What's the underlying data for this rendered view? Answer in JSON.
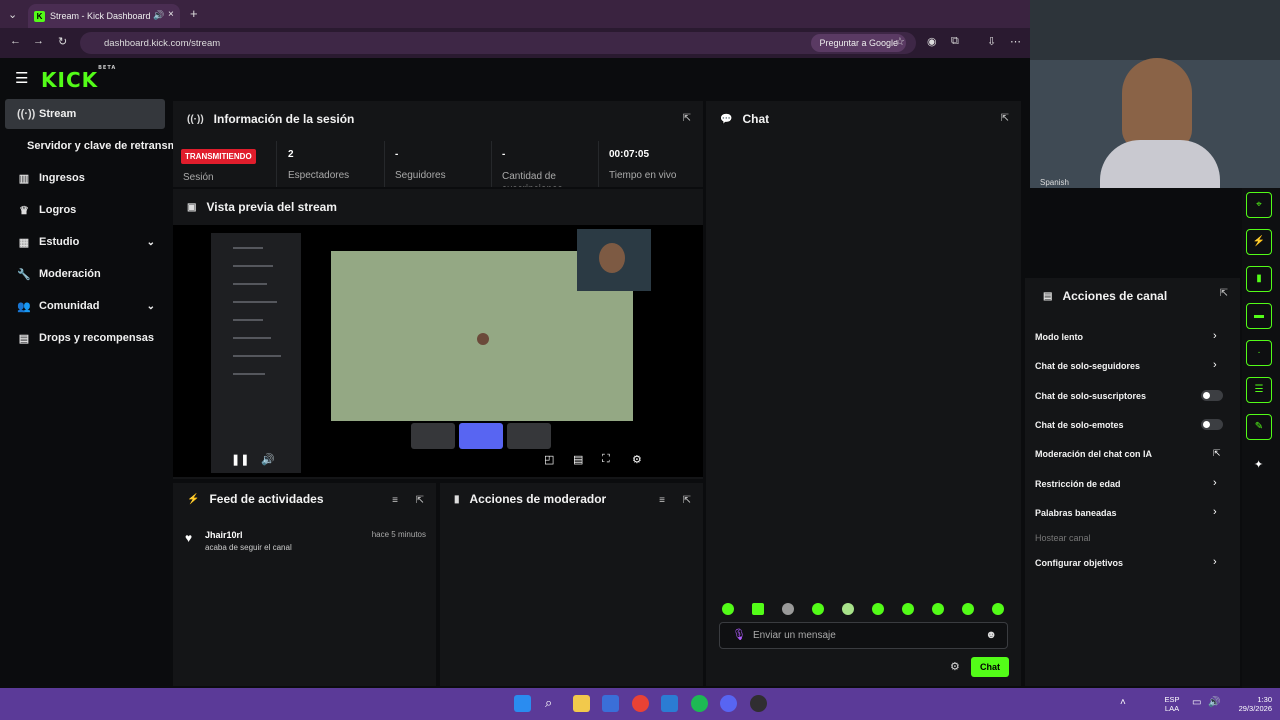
{
  "browser": {
    "tab_title": "Stream - Kick Dashboard",
    "url": "dashboard.kick.com/stream",
    "ask_google": "Preguntar a Google"
  },
  "brand": {
    "logo": "KICK",
    "beta": "BETA"
  },
  "sidebar": {
    "items": [
      {
        "label": "Stream",
        "icon": "broadcast-icon",
        "active": true
      },
      {
        "label": "Servidor y clave de retransmisión",
        "icon": "",
        "active": false
      },
      {
        "label": "Ingresos",
        "icon": "bar-chart-icon",
        "active": false
      },
      {
        "label": "Logros",
        "icon": "trophy-icon",
        "active": false
      },
      {
        "label": "Estudio",
        "icon": "grid-icon",
        "active": false,
        "expandable": true
      },
      {
        "label": "Moderación",
        "icon": "wrench-icon",
        "active": false
      },
      {
        "label": "Comunidad",
        "icon": "users-icon",
        "active": false,
        "expandable": true
      },
      {
        "label": "Drops y recompensas",
        "icon": "gift-icon",
        "active": false
      }
    ]
  },
  "session": {
    "title": "Información de la sesión",
    "live_badge": "TRANSMITIENDO",
    "session_label": "Sesión",
    "stats": [
      {
        "value": "2",
        "label": "Espectadores"
      },
      {
        "value": "-",
        "label": "Seguidores"
      },
      {
        "value": "-",
        "label": "Cantidad de suscripciones"
      },
      {
        "value": "00:07:05",
        "label": "Tiempo en vivo"
      }
    ]
  },
  "preview": {
    "title": "Vista previa del stream"
  },
  "feed": {
    "title": "Feed de actividades",
    "items": [
      {
        "user": "Jhair10rl",
        "text": "acaba de seguir el canal",
        "time": "hace 5 minutos"
      }
    ]
  },
  "mod_actions": {
    "title": "Acciones de moderador"
  },
  "chat": {
    "title": "Chat",
    "input_placeholder": "Enviar un mensaje",
    "send_label": "Chat",
    "language_tag": "Spanish"
  },
  "channel_actions": {
    "title": "Acciones de canal",
    "items": [
      {
        "label": "Modo lento",
        "control": "arrow"
      },
      {
        "label": "Chat de solo-seguidores",
        "control": "arrow"
      },
      {
        "label": "Chat de solo-suscriptores",
        "control": "toggle",
        "on": false
      },
      {
        "label": "Chat de solo-emotes",
        "control": "toggle",
        "on": false
      },
      {
        "label": "Moderación del chat con IA",
        "control": "external"
      },
      {
        "label": "Restricción de edad",
        "control": "arrow"
      },
      {
        "label": "Palabras baneadas",
        "control": "arrow"
      },
      {
        "label": "Hostear canal",
        "control": "none",
        "disabled": true
      },
      {
        "label": "Configurar objetivos",
        "control": "arrow"
      }
    ]
  },
  "taskbar": {
    "lang_top": "ESP",
    "lang_bottom": "LAA",
    "time": "1:30",
    "date": "29/3/2026"
  },
  "colors": {
    "accent": "#53fc18",
    "live": "#e01d2c",
    "taskbar": "#5b3a98"
  }
}
